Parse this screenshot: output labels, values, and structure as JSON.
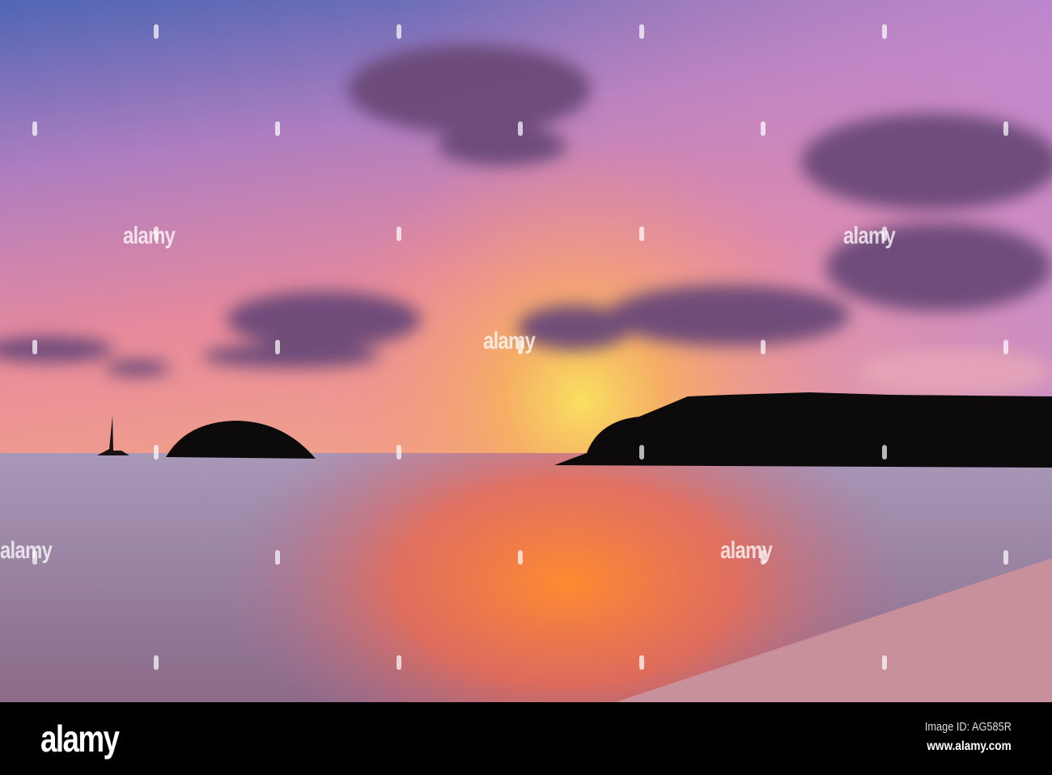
{
  "photo": {
    "subject": "sunset",
    "colors": {
      "sky_top": "#5a6cb5",
      "sky_pink": "#e38aa0",
      "sun_glow": "#f7d45a",
      "cloud": "#6b4a78",
      "silhouette": "#0d0a0c",
      "sea": "#9d8aa6",
      "reflection": "#f08040",
      "beach": "#c8909a"
    }
  },
  "watermark": {
    "text": "alamy"
  },
  "footer": {
    "logo": "alamy",
    "image_id": "Image ID: AG585R",
    "url": "www.alamy.com"
  }
}
